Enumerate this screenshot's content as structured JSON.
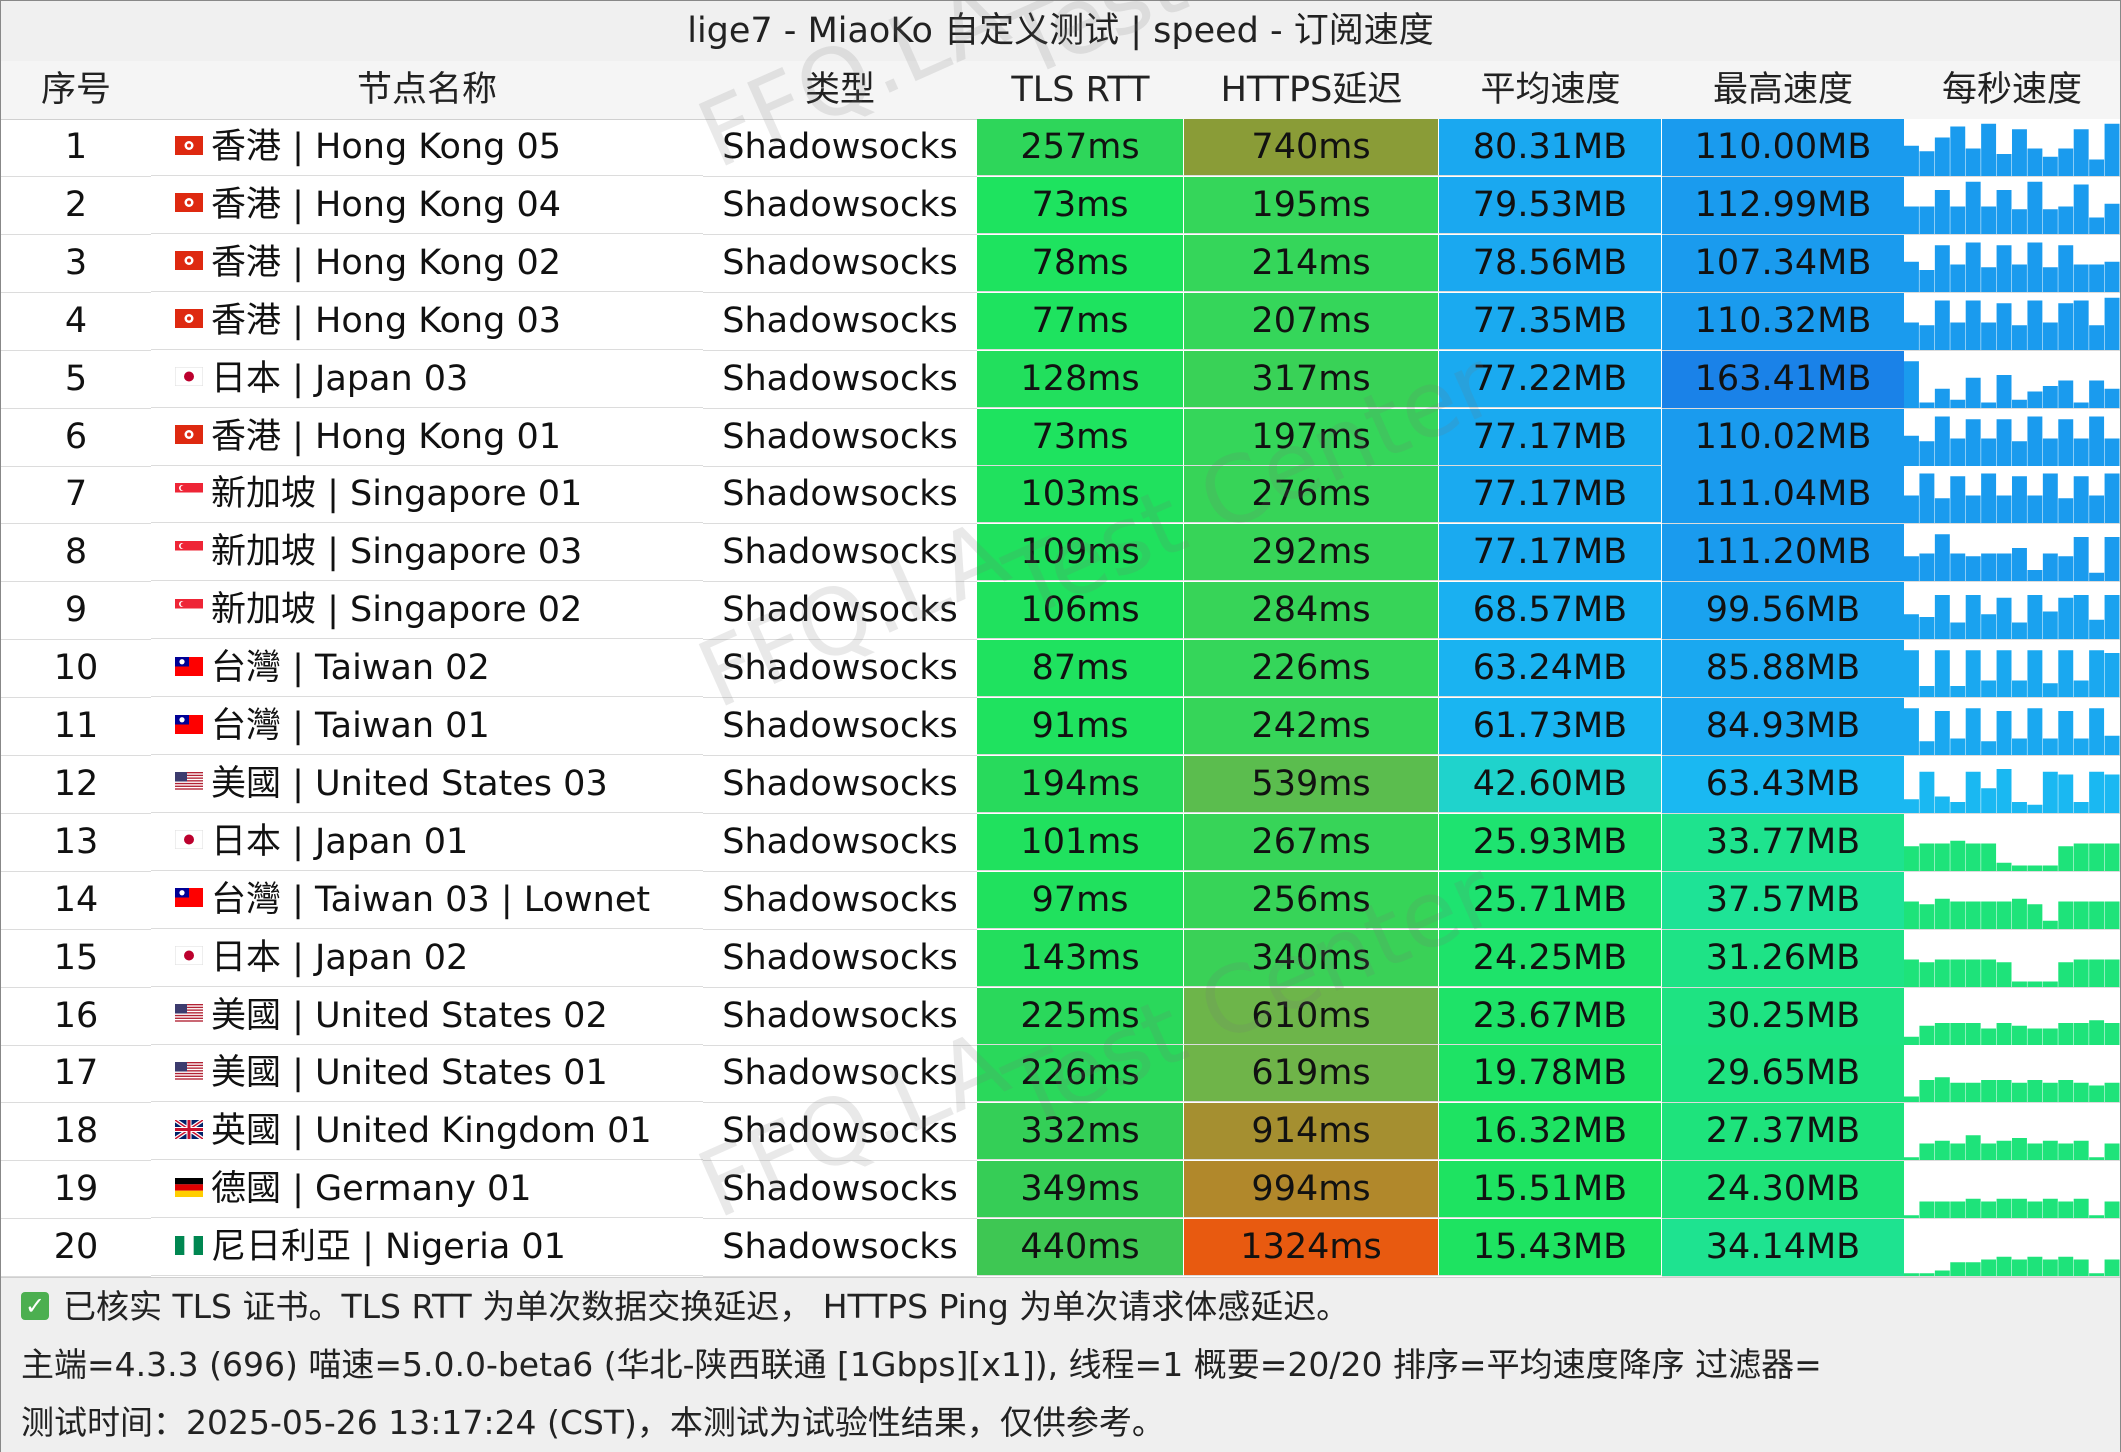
{
  "title": "lige7 - MiaoKo 自定义测试 | speed - 订阅速度",
  "headers": {
    "idx": "序号",
    "node": "节点名称",
    "type": "类型",
    "tls": "TLS RTT",
    "https": "HTTPS延迟",
    "avg": "平均速度",
    "max": "最高速度",
    "persec": "每秒速度"
  },
  "watermark": [
    "FFQ.LA",
    "Test Center"
  ],
  "colors": {
    "green": "#1ee35f",
    "blue": "#1996ec",
    "blue_peak": "#1a7fe6",
    "orange": "#e85a10",
    "olive": "#8a9c37"
  },
  "rows": [
    {
      "idx": "1",
      "flag": "hk",
      "node": "香港 | Hong Kong 05",
      "type": "Shadowsocks",
      "tls": "257ms",
      "https": "740ms",
      "avg": "80.31MB",
      "max": "110.00MB",
      "tls_color": "#2ed65a",
      "https_color": "#8a9c37",
      "avg_color": "#1aa8f0",
      "max_color": "#1a9bee",
      "spark_color": "#1a9bee",
      "spark": [
        0.55,
        0.45,
        0.7,
        0.9,
        0.5,
        0.95,
        0.4,
        0.85,
        0.5,
        0.35,
        0.5,
        0.85,
        0.3,
        0.95
      ]
    },
    {
      "idx": "2",
      "flag": "hk",
      "node": "香港 | Hong Kong 04",
      "type": "Shadowsocks",
      "tls": "73ms",
      "https": "195ms",
      "avg": "79.53MB",
      "max": "112.99MB",
      "tls_color": "#1ee35f",
      "https_color": "#35d65a",
      "avg_color": "#1aa8f0",
      "max_color": "#1a9bee",
      "spark_color": "#1a9bee",
      "spark": [
        0.5,
        0.5,
        0.8,
        0.5,
        0.95,
        0.5,
        0.8,
        0.45,
        0.95,
        0.45,
        0.5,
        0.9,
        0.3,
        0.55
      ]
    },
    {
      "idx": "3",
      "flag": "hk",
      "node": "香港 | Hong Kong 02",
      "type": "Shadowsocks",
      "tls": "78ms",
      "https": "214ms",
      "avg": "78.56MB",
      "max": "107.34MB",
      "tls_color": "#1ee35f",
      "https_color": "#35d65a",
      "avg_color": "#1aa8f0",
      "max_color": "#1a9bee",
      "spark_color": "#1a9bee",
      "spark": [
        0.55,
        0.4,
        0.85,
        0.5,
        0.9,
        0.45,
        0.85,
        0.5,
        0.9,
        0.45,
        0.85,
        0.5,
        0.5,
        0.55
      ]
    },
    {
      "idx": "4",
      "flag": "hk",
      "node": "香港 | Hong Kong 03",
      "type": "Shadowsocks",
      "tls": "77ms",
      "https": "207ms",
      "avg": "77.35MB",
      "max": "110.32MB",
      "tls_color": "#1ee35f",
      "https_color": "#35d65a",
      "avg_color": "#1aaaf0",
      "max_color": "#1a9bee",
      "spark_color": "#1a9bee",
      "spark": [
        0.5,
        0.45,
        0.9,
        0.5,
        0.9,
        0.5,
        0.85,
        0.45,
        0.9,
        0.5,
        0.85,
        0.9,
        0.45,
        0.95
      ]
    },
    {
      "idx": "5",
      "flag": "jp",
      "node": "日本 | Japan 03",
      "type": "Shadowsocks",
      "tls": "128ms",
      "https": "317ms",
      "avg": "77.22MB",
      "max": "163.41MB",
      "tls_color": "#22df5d",
      "https_color": "#39d257",
      "avg_color": "#1aaaf0",
      "max_color": "#1a82e8",
      "spark_color": "#1a9bee",
      "spark": [
        0.85,
        0.1,
        0.35,
        0.15,
        0.55,
        0.1,
        0.6,
        0.15,
        0.3,
        0.4,
        0.5,
        0.1,
        0.5,
        0.35
      ]
    },
    {
      "idx": "6",
      "flag": "hk",
      "node": "香港 | Hong Kong 01",
      "type": "Shadowsocks",
      "tls": "73ms",
      "https": "197ms",
      "avg": "77.17MB",
      "max": "110.02MB",
      "tls_color": "#1ee35f",
      "https_color": "#35d65a",
      "avg_color": "#1aaaf0",
      "max_color": "#1a9bee",
      "spark_color": "#1a9bee",
      "spark": [
        0.55,
        0.45,
        0.9,
        0.5,
        0.85,
        0.5,
        0.85,
        0.45,
        0.9,
        0.5,
        0.85,
        0.5,
        0.9,
        0.5
      ]
    },
    {
      "idx": "7",
      "flag": "sg",
      "node": "新加坡 | Singapore 01",
      "type": "Shadowsocks",
      "tls": "103ms",
      "https": "276ms",
      "avg": "77.17MB",
      "max": "111.04MB",
      "tls_color": "#20e15e",
      "https_color": "#37d458",
      "avg_color": "#1aaaf0",
      "max_color": "#1a9bee",
      "spark_color": "#1a9bee",
      "spark": [
        0.5,
        0.9,
        0.45,
        0.85,
        0.5,
        0.9,
        0.5,
        0.85,
        0.5,
        0.9,
        0.45,
        0.85,
        0.5,
        0.9
      ]
    },
    {
      "idx": "8",
      "flag": "sg",
      "node": "新加坡 | Singapore 03",
      "type": "Shadowsocks",
      "tls": "109ms",
      "https": "292ms",
      "avg": "77.17MB",
      "max": "111.20MB",
      "tls_color": "#20e15e",
      "https_color": "#37d458",
      "avg_color": "#1aaaf0",
      "max_color": "#1a9bee",
      "spark_color": "#1a9bee",
      "spark": [
        0.45,
        0.5,
        0.85,
        0.5,
        0.45,
        0.5,
        0.5,
        0.6,
        0.2,
        0.5,
        0.45,
        0.8,
        0.15,
        0.8
      ]
    },
    {
      "idx": "9",
      "flag": "sg",
      "node": "新加坡 | Singapore 02",
      "type": "Shadowsocks",
      "tls": "106ms",
      "https": "284ms",
      "avg": "68.57MB",
      "max": "99.56MB",
      "tls_color": "#20e15e",
      "https_color": "#37d458",
      "avg_color": "#1ab0f1",
      "max_color": "#1aa2ef",
      "spark_color": "#1aa2ef",
      "spark": [
        0.45,
        0.4,
        0.8,
        0.3,
        0.8,
        0.45,
        0.75,
        0.3,
        0.8,
        0.5,
        0.75,
        0.8,
        0.35,
        0.8
      ]
    },
    {
      "idx": "10",
      "flag": "tw",
      "node": "台灣 | Taiwan 02",
      "type": "Shadowsocks",
      "tls": "87ms",
      "https": "226ms",
      "avg": "63.24MB",
      "max": "85.88MB",
      "tls_color": "#1fe25f",
      "https_color": "#35d65a",
      "avg_color": "#1ab3f1",
      "max_color": "#1aa8f0",
      "spark_color": "#1aa8f0",
      "spark": [
        0.85,
        0.2,
        0.85,
        0.2,
        0.85,
        0.3,
        0.85,
        0.3,
        0.85,
        0.25,
        0.85,
        0.3,
        0.85,
        0.8
      ]
    },
    {
      "idx": "11",
      "flag": "tw",
      "node": "台灣 | Taiwan 01",
      "type": "Shadowsocks",
      "tls": "91ms",
      "https": "242ms",
      "avg": "61.73MB",
      "max": "84.93MB",
      "tls_color": "#1fe25f",
      "https_color": "#36d559",
      "avg_color": "#1ab5f1",
      "max_color": "#1aa8f0",
      "spark_color": "#1aa8f0",
      "spark": [
        0.85,
        0.25,
        0.8,
        0.3,
        0.85,
        0.25,
        0.8,
        0.3,
        0.85,
        0.3,
        0.8,
        0.3,
        0.85,
        0.35
      ]
    },
    {
      "idx": "12",
      "flag": "us",
      "node": "美國 | United States 03",
      "type": "Shadowsocks",
      "tls": "194ms",
      "https": "539ms",
      "avg": "42.60MB",
      "max": "63.43MB",
      "tls_color": "#28da5c",
      "https_color": "#5bbd4e",
      "avg_color": "#1fd3cc",
      "max_color": "#1ab8f2",
      "spark_color": "#1ab8f2",
      "spark": [
        0.25,
        0.75,
        0.3,
        0.2,
        0.75,
        0.45,
        0.8,
        0.2,
        0.15,
        0.75,
        0.7,
        0.2,
        0.75,
        0.7
      ]
    },
    {
      "idx": "13",
      "flag": "jp",
      "node": "日本 | Japan 01",
      "type": "Shadowsocks",
      "tls": "101ms",
      "https": "267ms",
      "avg": "25.93MB",
      "max": "33.77MB",
      "tls_color": "#20e15e",
      "https_color": "#37d458",
      "avg_color": "#1ee370",
      "max_color": "#1ee38e",
      "spark_color": "#1ee37a",
      "spark": [
        0.45,
        0.5,
        0.5,
        0.55,
        0.5,
        0.5,
        0.15,
        0.1,
        0.1,
        0.1,
        0.45,
        0.5,
        0.5,
        0.5
      ]
    },
    {
      "idx": "14",
      "flag": "tw",
      "node": "台灣 | Taiwan 03 | Lownet",
      "type": "Shadowsocks",
      "tls": "97ms",
      "https": "256ms",
      "avg": "25.71MB",
      "max": "37.57MB",
      "tls_color": "#20e15e",
      "https_color": "#37d458",
      "avg_color": "#1ee370",
      "max_color": "#1ee396",
      "spark_color": "#1ee37a",
      "spark": [
        0.5,
        0.45,
        0.55,
        0.5,
        0.5,
        0.5,
        0.5,
        0.55,
        0.45,
        0.15,
        0.5,
        0.5,
        0.5,
        0.5
      ]
    },
    {
      "idx": "15",
      "flag": "jp",
      "node": "日本 | Japan 02",
      "type": "Shadowsocks",
      "tls": "143ms",
      "https": "340ms",
      "avg": "24.25MB",
      "max": "31.26MB",
      "tls_color": "#23de5d",
      "https_color": "#3ad157",
      "avg_color": "#1ee36a",
      "max_color": "#1ee386",
      "spark_color": "#1ee37a",
      "spark": [
        0.5,
        0.45,
        0.5,
        0.5,
        0.5,
        0.5,
        0.45,
        0.1,
        0.1,
        0.1,
        0.45,
        0.5,
        0.5,
        0.5
      ]
    },
    {
      "idx": "16",
      "flag": "us",
      "node": "美國 | United States 02",
      "type": "Shadowsocks",
      "tls": "225ms",
      "https": "610ms",
      "avg": "23.67MB",
      "max": "30.25MB",
      "tls_color": "#2ad85b",
      "https_color": "#6db54a",
      "avg_color": "#1ee368",
      "max_color": "#1ee382",
      "spark_color": "#1ee37a",
      "spark": [
        0.15,
        0.35,
        0.4,
        0.4,
        0.4,
        0.3,
        0.4,
        0.35,
        0.3,
        0.3,
        0.4,
        0.4,
        0.45,
        0.4
      ]
    },
    {
      "idx": "17",
      "flag": "us",
      "node": "美國 | United States 01",
      "type": "Shadowsocks",
      "tls": "226ms",
      "https": "619ms",
      "avg": "19.78MB",
      "max": "29.65MB",
      "tls_color": "#2ad85b",
      "https_color": "#6fb449",
      "avg_color": "#1ee365",
      "max_color": "#1ee380",
      "spark_color": "#1ee37a",
      "spark": [
        0.1,
        0.4,
        0.45,
        0.35,
        0.35,
        0.4,
        0.4,
        0.35,
        0.4,
        0.35,
        0.4,
        0.35,
        0.3,
        0.35
      ]
    },
    {
      "idx": "18",
      "flag": "uk",
      "node": "英國 | United Kingdom 01",
      "type": "Shadowsocks",
      "tls": "332ms",
      "https": "914ms",
      "avg": "16.32MB",
      "max": "27.37MB",
      "tls_color": "#34cf57",
      "https_color": "#a58f30",
      "avg_color": "#1ee362",
      "max_color": "#1ee37c",
      "spark_color": "#1ee37a",
      "spark": [
        0.05,
        0.3,
        0.35,
        0.3,
        0.45,
        0.3,
        0.35,
        0.4,
        0.3,
        0.35,
        0.3,
        0.35,
        0.05,
        0.3
      ]
    },
    {
      "idx": "19",
      "flag": "de",
      "node": "德國 | Germany 01",
      "type": "Shadowsocks",
      "tls": "349ms",
      "https": "994ms",
      "avg": "15.51MB",
      "max": "24.30MB",
      "tls_color": "#36cd56",
      "https_color": "#b1882b",
      "avg_color": "#1ee361",
      "max_color": "#1ee378",
      "spark_color": "#1ee37a",
      "spark": [
        0.05,
        0.3,
        0.3,
        0.3,
        0.35,
        0.3,
        0.35,
        0.35,
        0.3,
        0.35,
        0.3,
        0.35,
        0.05,
        0.3
      ]
    },
    {
      "idx": "20",
      "flag": "ng",
      "node": "尼日利亞 | Nigeria 01",
      "type": "Shadowsocks",
      "tls": "440ms",
      "https": "1324ms",
      "avg": "15.43MB",
      "max": "34.14MB",
      "tls_color": "#3ec753",
      "https_color": "#e85a10",
      "avg_color": "#1ee361",
      "max_color": "#1ee390",
      "spark_color": "#1ee37a",
      "spark": [
        0.05,
        0.05,
        0.1,
        0.25,
        0.25,
        0.3,
        0.35,
        0.3,
        0.35,
        0.3,
        0.35,
        0.3,
        0.05,
        0.3
      ]
    }
  ],
  "footer": {
    "line1": "已核实 TLS 证书。TLS RTT 为单次数据交换延迟， HTTPS Ping 为单次请求体感延迟。",
    "line2": "主端=4.3.3 (696) 喵速=5.0.0-beta6 (华北-陕西联通 [1Gbps][x1]), 线程=1 概要=20/20 排序=平均速度降序 过滤器=",
    "line3": "测试时间：2025-05-26 13:17:24 (CST)，本测试为试验性结果，仅供参考。"
  }
}
